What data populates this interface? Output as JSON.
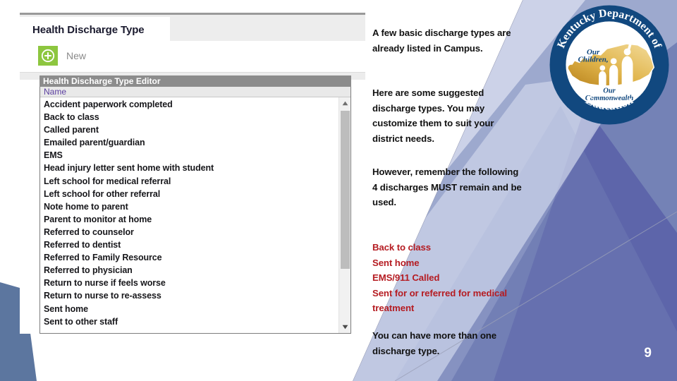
{
  "slide": {
    "page_number": "9",
    "paragraphs": {
      "intro": "A few basic discharge types are already listed in Campus.",
      "suggested": "Here are some suggested discharge types.  You may customize them to suit your district needs.",
      "warning": "However, remember the following 4 discharges MUST remain and be used.",
      "required_list": "Back to class\nSent home\nEMS/911 Called\nSent for or referred for medical treatment",
      "closing": "You can have more than one discharge type."
    },
    "accent_red": "#b51c22",
    "logo": {
      "name": "kentucky-department-of-education-seal",
      "ring_top_text": "Kentucky Department of",
      "ring_bottom_text": "Education",
      "inner_top_text_line1": "Our",
      "inner_top_text_line2": "Children,",
      "inner_bottom_text_line1": "Our",
      "inner_bottom_text_line2": "Commonwealth",
      "ring_color": "#11487f",
      "map_color": "#d8a22c"
    }
  },
  "app": {
    "tab": {
      "label": "Health Discharge Type"
    },
    "toolbar": {
      "new_label": "New",
      "new_icon": "plus-circle-icon",
      "new_icon_color": "#8dc63f"
    },
    "editor": {
      "title": "Health Discharge Type Editor",
      "column_header": "Name",
      "column_header_color": "#5b3fa0",
      "rows": [
        "Accident paperwork completed",
        "Back to class",
        "Called parent",
        "Emailed parent/guardian",
        "EMS",
        "Head injury letter sent home with student",
        "Left school for medical referral",
        "Left school for other referral",
        "Note home to parent",
        "Parent to monitor at home",
        "Referred to counselor",
        "Referred to dentist",
        "Referred to Family Resource",
        "Referred to physician",
        "Return to nurse if feels worse",
        "Return to nurse to re-assess",
        "Sent home",
        "Sent to other staff"
      ],
      "scrollbar": {
        "up_arrow": "scroll-up-arrow-icon",
        "down_arrow": "scroll-down-arrow-icon"
      }
    }
  }
}
